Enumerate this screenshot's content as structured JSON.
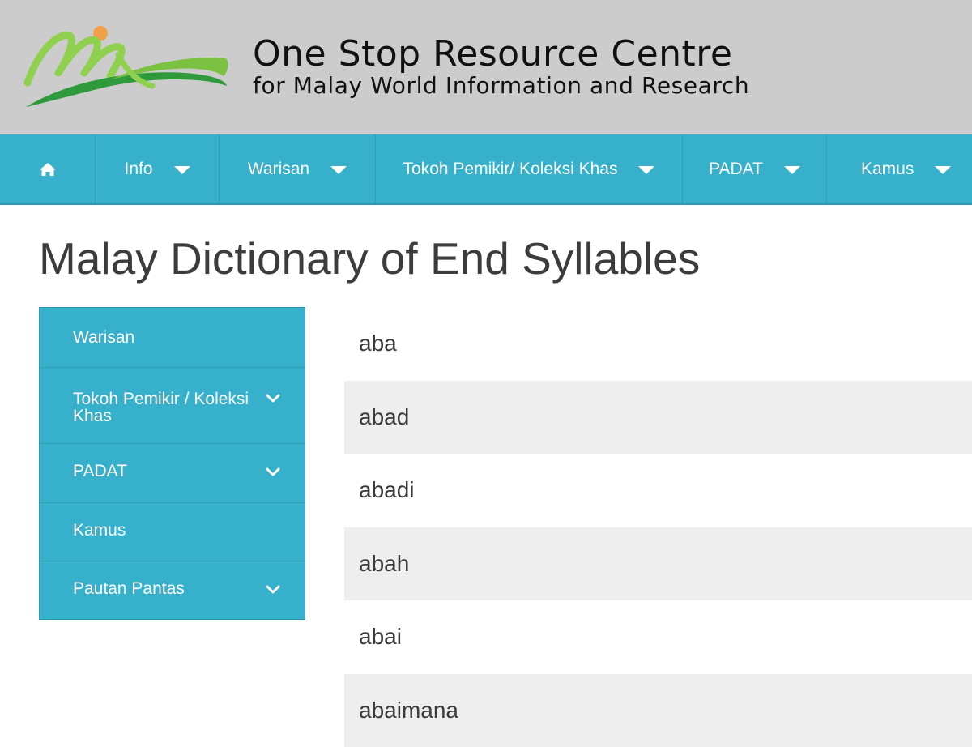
{
  "header": {
    "title": "One Stop Resource Centre",
    "subtitle": "for Malay World Information and Research",
    "logo_icon": "malay-world-logo-icon"
  },
  "colors": {
    "nav_bg": "#37b0cb",
    "banner_bg": "#cccccc",
    "row_alt_bg": "#eeeeee",
    "text": "#3c3c3c"
  },
  "topnav": {
    "home_icon": "home-icon",
    "items": [
      {
        "label": "Info",
        "has_dropdown": true
      },
      {
        "label": "Warisan",
        "has_dropdown": true
      },
      {
        "label": "Tokoh Pemikir/ Koleksi Khas",
        "has_dropdown": true
      },
      {
        "label": "PADAT",
        "has_dropdown": true
      },
      {
        "label": "Kamus",
        "has_dropdown": true
      }
    ]
  },
  "page": {
    "title": "Malay Dictionary of End Syllables"
  },
  "sidebar": {
    "items": [
      {
        "label": "Warisan",
        "expandable": false
      },
      {
        "label": "Tokoh Pemikir / Koleksi Khas",
        "expandable": true
      },
      {
        "label": "PADAT",
        "expandable": true
      },
      {
        "label": "Kamus",
        "expandable": false
      },
      {
        "label": "Pautan Pantas",
        "expandable": true
      }
    ]
  },
  "words": [
    "aba",
    "abad",
    "abadi",
    "abah",
    "abai",
    "abaimana"
  ]
}
